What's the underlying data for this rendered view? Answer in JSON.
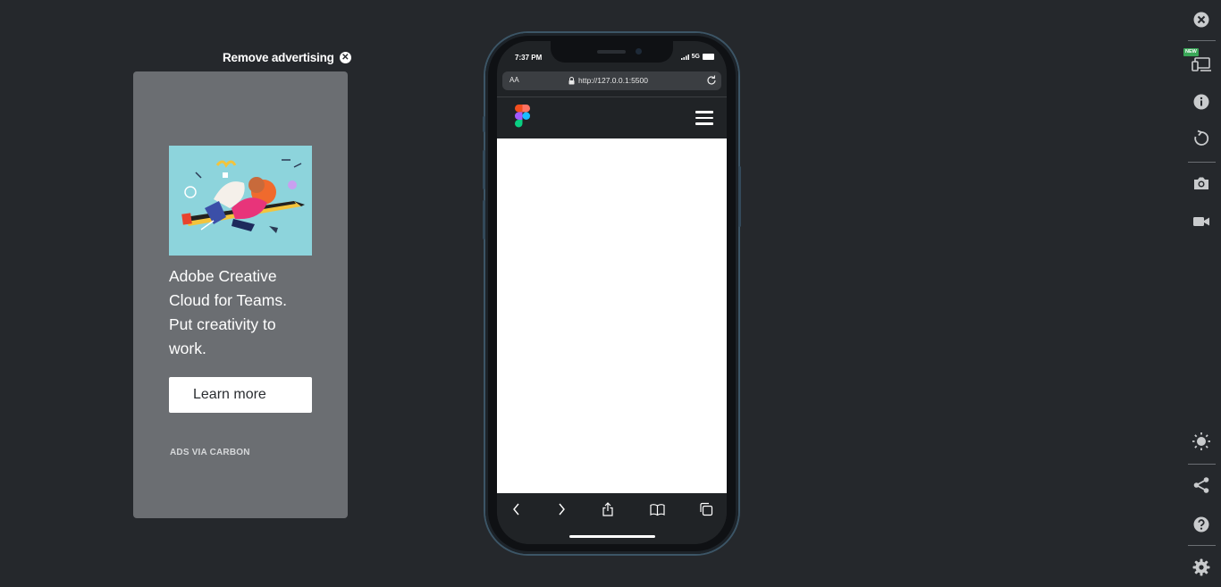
{
  "ad": {
    "remove_label": "Remove advertising",
    "text": "Adobe Creative Cloud for Teams. Put creativity to work.",
    "cta": "Learn more",
    "credit": "ADS VIA CARBON"
  },
  "phone": {
    "time": "7:37 PM",
    "network": "5G",
    "url_aa": "AA",
    "url": "http://127.0.0.1:5500"
  },
  "toolbar": {
    "new_badge": "NEW"
  },
  "icons": [
    "close-icon",
    "devices-icon",
    "info-icon",
    "rotate-icon",
    "camera-icon",
    "video-icon",
    "brightness-icon",
    "share-icon",
    "help-icon",
    "settings-icon"
  ],
  "colors": {
    "background": "#25282c",
    "ad_card": "#6b6e72",
    "phone_frame_edge": "#3c5566",
    "new_badge": "#3aa758"
  }
}
